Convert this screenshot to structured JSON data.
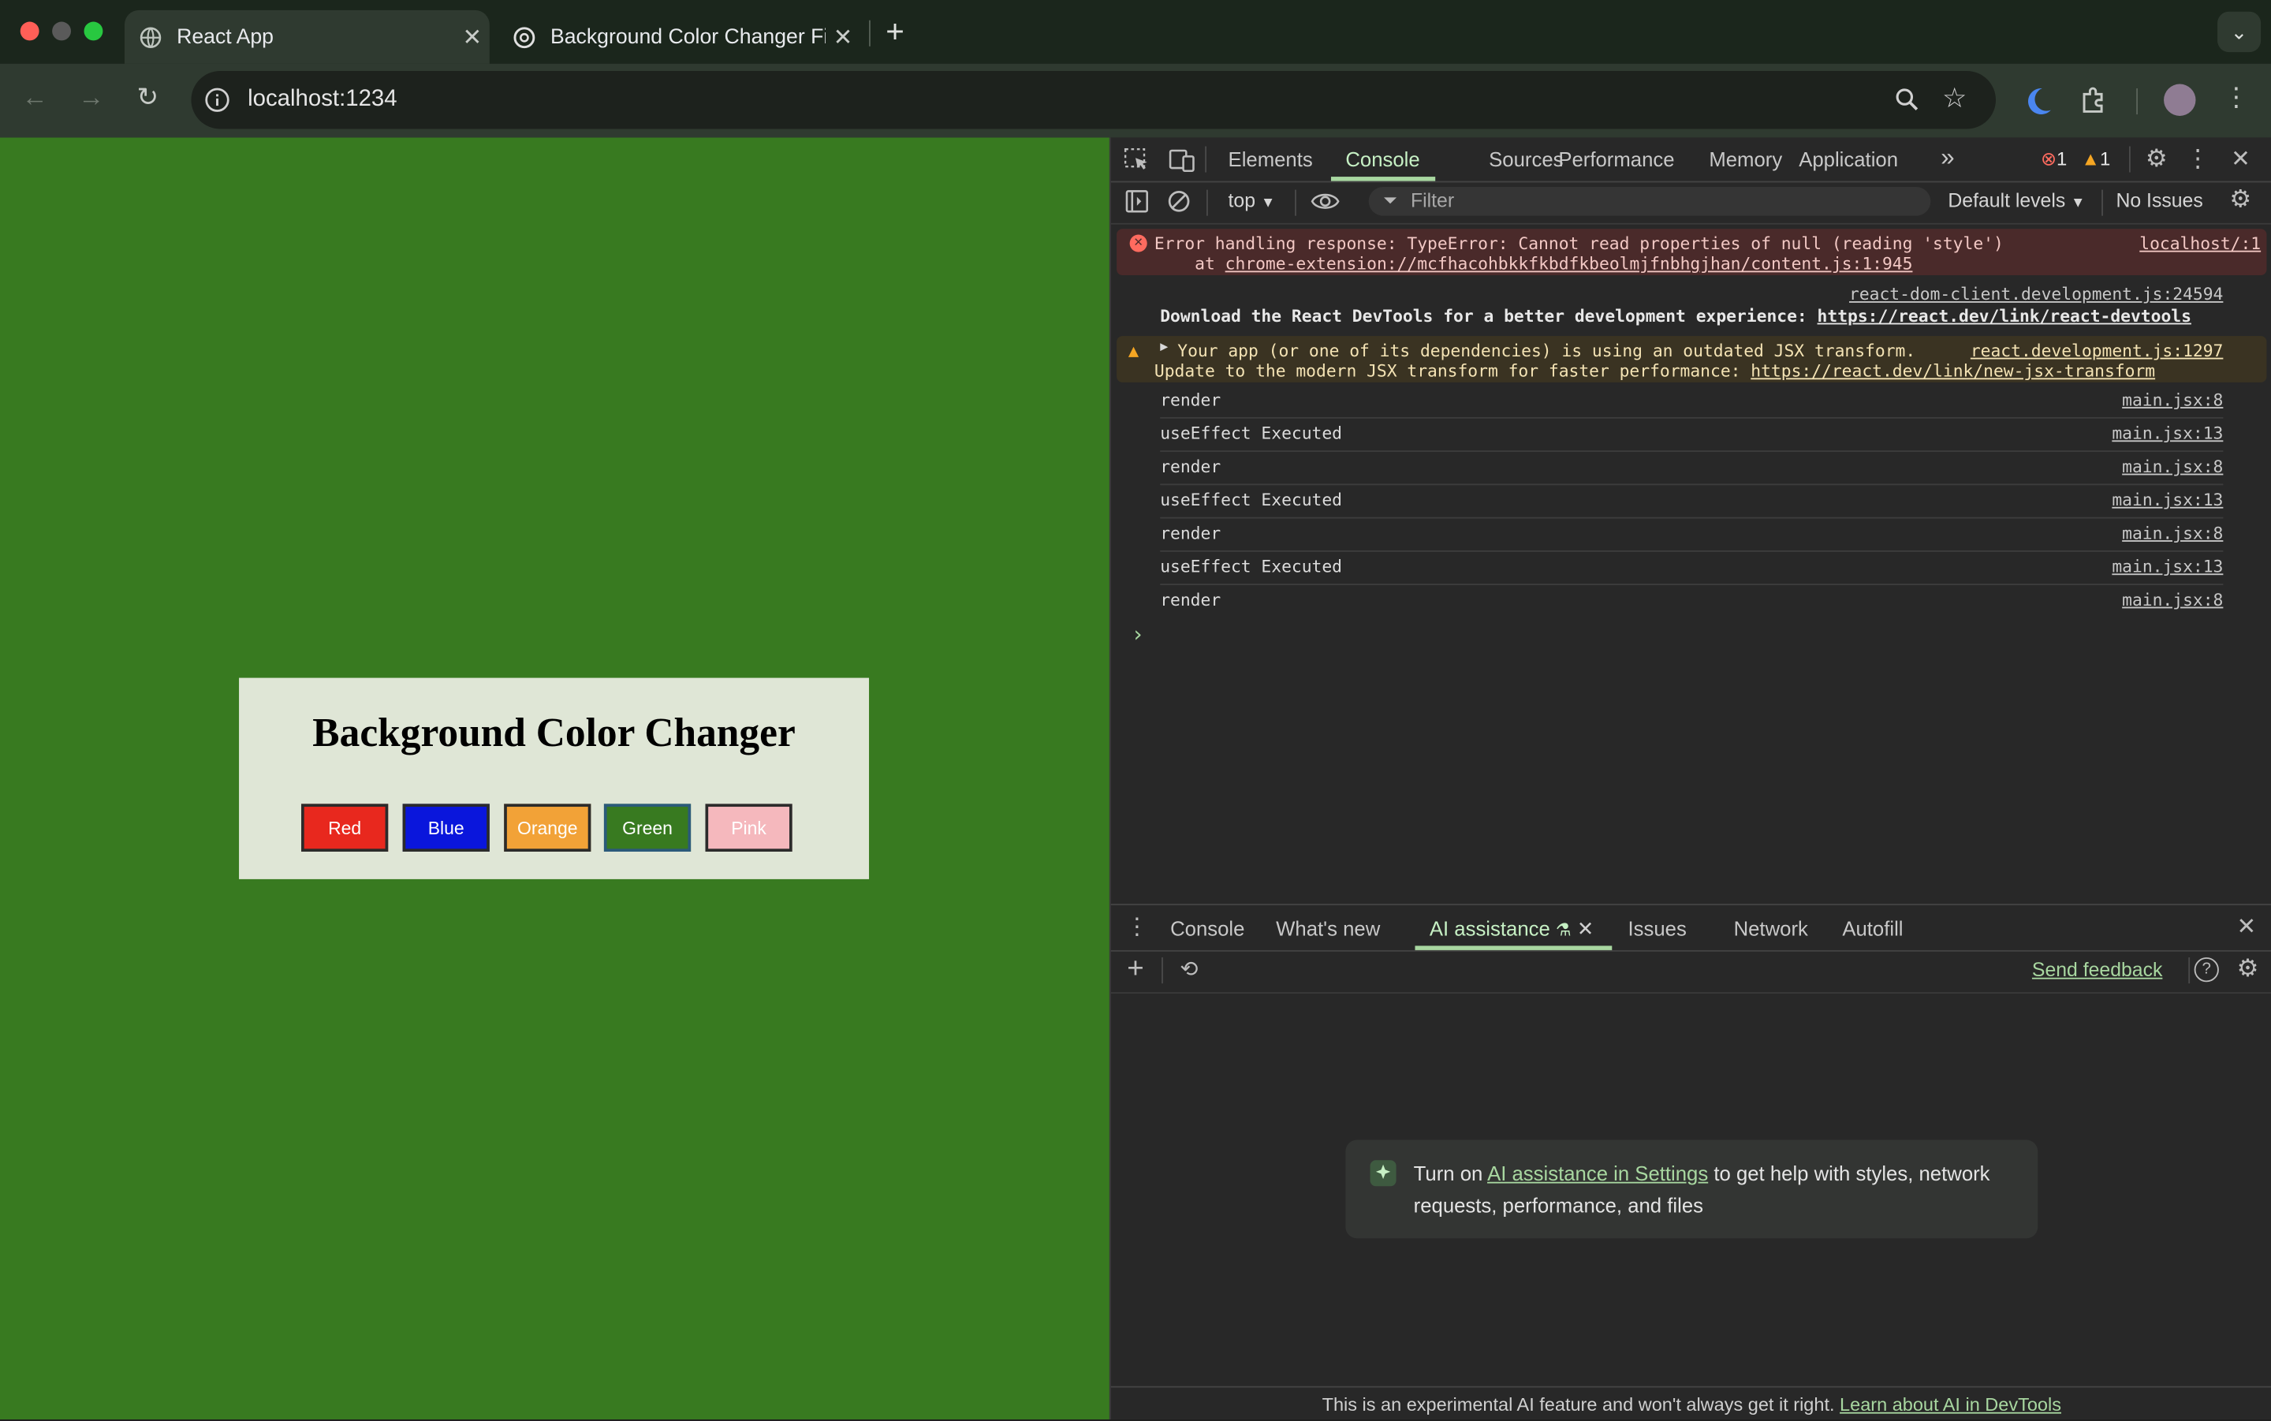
{
  "browser": {
    "tabs": [
      {
        "title": "React App",
        "active": true
      },
      {
        "title": "Background Color Changer Fi",
        "active": false
      }
    ],
    "new_tab": "+",
    "url": "localhost:1234"
  },
  "page": {
    "heading": "Background Color Changer",
    "buttons": [
      {
        "label": "Red",
        "bg": "#e8281e",
        "fg": "#ffffff"
      },
      {
        "label": "Blue",
        "bg": "#0a16dc",
        "fg": "#ffffff"
      },
      {
        "label": "Orange",
        "bg": "#f2a237",
        "fg": "#ffffff"
      },
      {
        "label": "Green",
        "bg": "#387a20",
        "fg": "#ffffff"
      },
      {
        "label": "Pink",
        "bg": "#f5b8bd",
        "fg": "#ffffff"
      }
    ],
    "background": "#387a20"
  },
  "devtools": {
    "tabs": [
      "Elements",
      "Console",
      "Sources",
      "Performance",
      "Memory",
      "Application"
    ],
    "active_tab": "Console",
    "more_tabs": "»",
    "error_count": "1",
    "warning_count": "1",
    "context": "top",
    "filter_placeholder": "Filter",
    "levels": "Default levels",
    "issues": "No Issues",
    "console": {
      "error": {
        "line1": "Error handling response: TypeError: Cannot read properties of null (reading 'style')",
        "line2_prefix": "    at ",
        "line2_link": "chrome-extension://mcfhacohbkkfkbdfkbeolmjfnbhgjhan/content.js:1:945",
        "source": "localhost/:1"
      },
      "info": {
        "source": "react-dom-client.development.js:24594",
        "text": "Download the React DevTools for a better development experience: ",
        "link": "https://react.dev/link/react-devtools"
      },
      "warning": {
        "line1": "Your app (or one of its dependencies) is using an outdated JSX transform.",
        "line2": "Update to the modern JSX transform for faster performance: ",
        "link": "https://react.dev/link/new-jsx-transform",
        "source": "react.development.js:1297"
      },
      "logs": [
        {
          "text": "render",
          "source": "main.jsx:8"
        },
        {
          "text": "useEffect Executed",
          "source": "main.jsx:13"
        },
        {
          "text": "render",
          "source": "main.jsx:8"
        },
        {
          "text": "useEffect Executed",
          "source": "main.jsx:13"
        },
        {
          "text": "render",
          "source": "main.jsx:8"
        },
        {
          "text": "useEffect Executed",
          "source": "main.jsx:13"
        },
        {
          "text": "render",
          "source": "main.jsx:8"
        }
      ],
      "prompt": "›"
    },
    "drawer": {
      "tabs": [
        "Console",
        "What's new",
        "AI assistance",
        "Issues",
        "Network",
        "Autofill"
      ],
      "active_tab": "AI assistance",
      "send_feedback": "Send feedback",
      "callout_prefix": "Turn on ",
      "callout_link": "AI assistance in Settings",
      "callout_suffix": " to get help with styles, network requests, performance, and files",
      "footer_text": "This is an experimental AI feature and won't always get it right. ",
      "footer_link": "Learn about AI in DevTools"
    }
  }
}
